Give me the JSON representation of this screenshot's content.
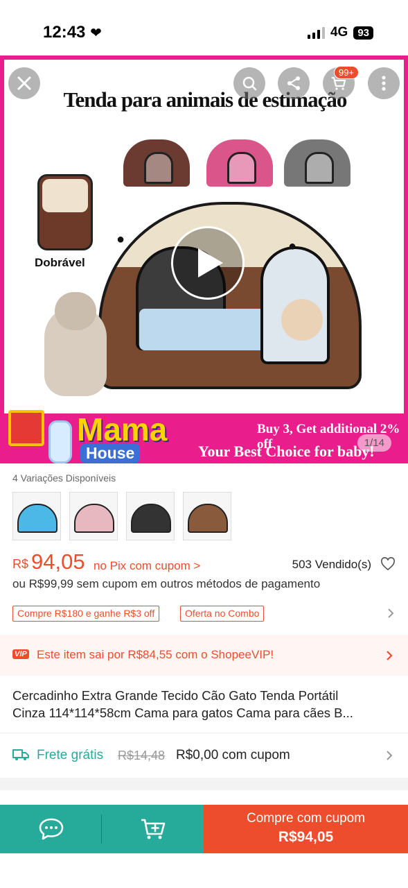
{
  "status_bar": {
    "time": "12:43",
    "network": "4G",
    "battery": "93"
  },
  "hero": {
    "title": "Tenda para animais de estimação",
    "folded_label": "Dobrável",
    "brand_line1": "Mama",
    "brand_line2": "House",
    "promo_line1": "Buy 3, Get additional 2% off",
    "promo_line2": "Your Best Choice for baby!",
    "image_counter": "1/14",
    "cart_badge": "99+"
  },
  "variations": {
    "label": "4 Variações Disponíveis",
    "count": 4
  },
  "price": {
    "currency": "R$",
    "value": "94,05",
    "pix_note": "no Pix com cupom >",
    "sold": "503 Vendido(s)",
    "alt_price": "ou R$99,99 sem cupom em outros métodos de pagamento"
  },
  "tags": [
    "Compre R$180 e ganhe R$3 off",
    "Oferta no Combo"
  ],
  "vip": {
    "badge": "VIP",
    "text": "Este item sai por R$84,55 com o ShopeeVIP!"
  },
  "product_title": {
    "line1": "Cercadinho Extra Grande Tecido Cão Gato Tenda Portátil",
    "line2": "Cinza 114*114*58cm Cama para gatos Cama para cães B..."
  },
  "shipping": {
    "free_label": "Frete grátis",
    "old_price": "R$14,48",
    "new_price": "R$0,00 com cupom"
  },
  "bottom_bar": {
    "buy_line1": "Compre com cupom",
    "buy_line2": "R$94,05"
  },
  "colors": {
    "accent": "#ee4d2d",
    "teal": "#26aa99",
    "pink": "#e91e8c"
  }
}
